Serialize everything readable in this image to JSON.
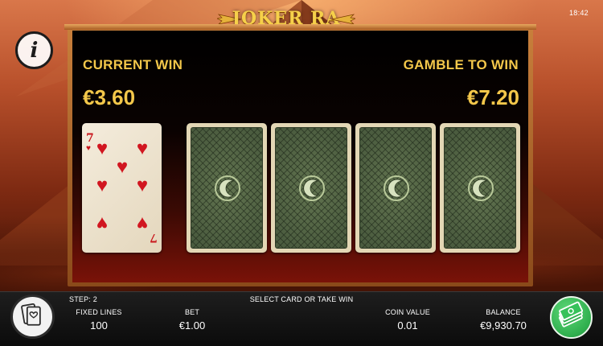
{
  "status_bar": {
    "clock": "18:42"
  },
  "header": {
    "logo_text": "JOKER RA"
  },
  "gamble": {
    "current_win_label": "CURRENT WIN",
    "current_win_value": "€3.60",
    "gamble_to_win_label": "GAMBLE TO WIN",
    "gamble_to_win_value": "€7.20",
    "dealer_card": {
      "rank": "7",
      "suit": "hearts"
    },
    "hidden_cards_count": 4
  },
  "footer": {
    "step_label": "STEP: 2",
    "instruction": "SELECT CARD OR TAKE WIN",
    "fields": [
      {
        "label": "FIXED LINES",
        "value": "100"
      },
      {
        "label": "BET",
        "value": "€1.00"
      },
      {
        "label": "COIN VALUE",
        "value": "0.01"
      },
      {
        "label": "BALANCE",
        "value": "€9,930.70"
      }
    ]
  },
  "icons": {
    "info": "info-icon",
    "gamble_cards": "cards-icon",
    "collect": "banknotes-icon"
  },
  "colors": {
    "gold_text": "#f3c74a",
    "panel_frame": "#c9803c",
    "hearts_red": "#d11620",
    "card_back_green": "#4b5c3f",
    "collect_green": "#2fae4d"
  }
}
